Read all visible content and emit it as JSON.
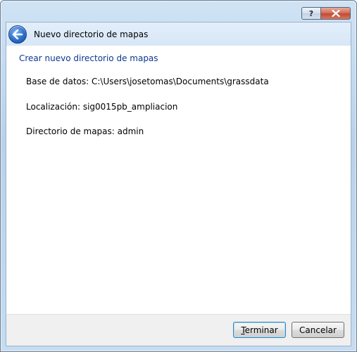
{
  "window": {
    "help_label": "?"
  },
  "wizard": {
    "title": "Nuevo directorio de mapas",
    "section_title": "Crear nuevo directorio de mapas",
    "info": {
      "database": "Base de datos: C:\\Users\\josetomas\\Documents\\grassdata",
      "location": "Localización: sig0015pb_ampliacion",
      "mapset": "Directorio de mapas: admin"
    }
  },
  "buttons": {
    "finish": "Terminar",
    "cancel": "Cancelar"
  },
  "colors": {
    "section_title": "#0c3791",
    "header_bg": "#d7e7f7",
    "footer_bg": "#f0f0f0"
  }
}
